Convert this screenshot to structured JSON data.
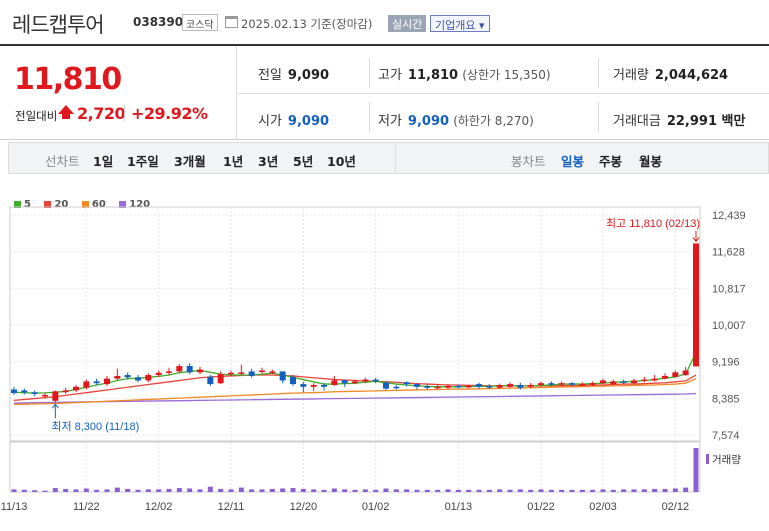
{
  "header": {
    "title": "레드캡투어",
    "code": "038390",
    "market_badge": "코스닥",
    "date": "2025.02.13 기준(장마감)",
    "realtime_label": "실시간",
    "company_label": "기업개요 ▾"
  },
  "summary": {
    "price": "11,810",
    "change_label": "전일대비",
    "change": "2,720",
    "change_pct": "+29.92%",
    "prev_close_label": "전일",
    "prev_close": "9,090",
    "high_label": "고가",
    "high": "11,810",
    "upper_limit": "(상한가 15,350)",
    "volume_label": "거래량",
    "volume": "2,044,624",
    "open_label": "시가",
    "open": "9,090",
    "low_label": "저가",
    "low": "9,090",
    "lower_limit": "(하한가 8,270)",
    "amount_label": "거래대금",
    "amount": "22,991 백만"
  },
  "period": {
    "line_label": "선차트",
    "line_options": [
      "1일",
      "1주일",
      "3개월",
      "1년",
      "3년",
      "5년",
      "10년"
    ],
    "candle_label": "봉차트",
    "candle_options": [
      "일봉",
      "주봉",
      "월봉"
    ],
    "active_candle": "일봉"
  },
  "colors": {
    "up": "#e0181d",
    "down": "#1460c0",
    "ma5": "#3fae2a",
    "ma20": "#e8443a",
    "ma60": "#f08a22",
    "ma120": "#9b6cd6"
  },
  "chart_data": {
    "type": "candlestick",
    "legend": [
      "5",
      "20",
      "60",
      "120"
    ],
    "y_ticks": [
      "12,439",
      "11,628",
      "10,817",
      "10,007",
      "9,196",
      "8,385",
      "7,574"
    ],
    "ylim": [
      7574,
      12439
    ],
    "x_ticks": [
      "11/13",
      "11/22",
      "12/02",
      "12/11",
      "12/20",
      "01/02",
      "01/13",
      "01/22",
      "02/03",
      "02/12"
    ],
    "max_annotation": "최고 11,810 (02/13)",
    "min_annotation": "최저 8,300 (11/18)",
    "volume_label": "거래량",
    "candles": [
      {
        "o": 8580,
        "c": 8500,
        "h": 8640,
        "l": 8460
      },
      {
        "o": 8560,
        "c": 8520,
        "h": 8600,
        "l": 8470
      },
      {
        "o": 8520,
        "c": 8480,
        "h": 8560,
        "l": 8430
      },
      {
        "o": 8440,
        "c": 8460,
        "h": 8500,
        "l": 8380
      },
      {
        "o": 8330,
        "c": 8540,
        "h": 8560,
        "l": 8300
      },
      {
        "o": 8520,
        "c": 8560,
        "h": 8620,
        "l": 8480
      },
      {
        "o": 8560,
        "c": 8640,
        "h": 8680,
        "l": 8520
      },
      {
        "o": 8620,
        "c": 8760,
        "h": 8800,
        "l": 8580
      },
      {
        "o": 8760,
        "c": 8720,
        "h": 8820,
        "l": 8680
      },
      {
        "o": 8700,
        "c": 8820,
        "h": 8880,
        "l": 8660
      },
      {
        "o": 8820,
        "c": 8880,
        "h": 9040,
        "l": 8780
      },
      {
        "o": 8900,
        "c": 8850,
        "h": 8960,
        "l": 8800
      },
      {
        "o": 8850,
        "c": 8780,
        "h": 8900,
        "l": 8740
      },
      {
        "o": 8780,
        "c": 8900,
        "h": 8940,
        "l": 8740
      },
      {
        "o": 8900,
        "c": 8950,
        "h": 9000,
        "l": 8860
      },
      {
        "o": 8960,
        "c": 8980,
        "h": 9060,
        "l": 8900
      },
      {
        "o": 8980,
        "c": 9100,
        "h": 9140,
        "l": 8940
      },
      {
        "o": 9100,
        "c": 8960,
        "h": 9160,
        "l": 8920
      },
      {
        "o": 8960,
        "c": 9020,
        "h": 9080,
        "l": 8920
      },
      {
        "o": 8860,
        "c": 8700,
        "h": 8900,
        "l": 8660
      },
      {
        "o": 8720,
        "c": 8920,
        "h": 8980,
        "l": 8700
      },
      {
        "o": 8920,
        "c": 8950,
        "h": 9000,
        "l": 8880
      },
      {
        "o": 8950,
        "c": 8960,
        "h": 9130,
        "l": 8900
      },
      {
        "o": 8980,
        "c": 8880,
        "h": 9040,
        "l": 8840
      },
      {
        "o": 8980,
        "c": 9000,
        "h": 9060,
        "l": 8940
      },
      {
        "o": 8960,
        "c": 8980,
        "h": 9020,
        "l": 8920
      },
      {
        "o": 8980,
        "c": 8780,
        "h": 8940,
        "l": 8720
      },
      {
        "o": 8860,
        "c": 8700,
        "h": 8900,
        "l": 8660
      },
      {
        "o": 8700,
        "c": 8640,
        "h": 8750,
        "l": 8520
      },
      {
        "o": 8640,
        "c": 8680,
        "h": 8720,
        "l": 8540
      },
      {
        "o": 8680,
        "c": 8640,
        "h": 8720,
        "l": 8560
      },
      {
        "o": 8680,
        "c": 8780,
        "h": 8880,
        "l": 8660
      },
      {
        "o": 8780,
        "c": 8720,
        "h": 8800,
        "l": 8640
      },
      {
        "o": 8720,
        "c": 8760,
        "h": 8800,
        "l": 8700
      },
      {
        "o": 8760,
        "c": 8800,
        "h": 8840,
        "l": 8720
      },
      {
        "o": 8800,
        "c": 8760,
        "h": 8840,
        "l": 8720
      },
      {
        "o": 8730,
        "c": 8600,
        "h": 8760,
        "l": 8560
      },
      {
        "o": 8640,
        "c": 8620,
        "h": 8680,
        "l": 8580
      },
      {
        "o": 8740,
        "c": 8700,
        "h": 8760,
        "l": 8650
      },
      {
        "o": 8700,
        "c": 8640,
        "h": 8720,
        "l": 8580
      },
      {
        "o": 8650,
        "c": 8620,
        "h": 8690,
        "l": 8580
      },
      {
        "o": 8620,
        "c": 8640,
        "h": 8680,
        "l": 8590
      },
      {
        "o": 8620,
        "c": 8660,
        "h": 8700,
        "l": 8590
      },
      {
        "o": 8660,
        "c": 8650,
        "h": 8690,
        "l": 8610
      },
      {
        "o": 8650,
        "c": 8660,
        "h": 8690,
        "l": 8610
      },
      {
        "o": 8700,
        "c": 8640,
        "h": 8730,
        "l": 8600
      },
      {
        "o": 8660,
        "c": 8620,
        "h": 8700,
        "l": 8590
      },
      {
        "o": 8620,
        "c": 8680,
        "h": 8710,
        "l": 8600
      },
      {
        "o": 8640,
        "c": 8700,
        "h": 8740,
        "l": 8610
      },
      {
        "o": 8680,
        "c": 8620,
        "h": 8730,
        "l": 8580
      },
      {
        "o": 8640,
        "c": 8680,
        "h": 8720,
        "l": 8610
      },
      {
        "o": 8680,
        "c": 8720,
        "h": 8760,
        "l": 8640
      },
      {
        "o": 8720,
        "c": 8690,
        "h": 8760,
        "l": 8650
      },
      {
        "o": 8690,
        "c": 8720,
        "h": 8760,
        "l": 8660
      },
      {
        "o": 8720,
        "c": 8690,
        "h": 8750,
        "l": 8650
      },
      {
        "o": 8690,
        "c": 8700,
        "h": 8740,
        "l": 8660
      },
      {
        "o": 8700,
        "c": 8720,
        "h": 8760,
        "l": 8660
      },
      {
        "o": 8720,
        "c": 8780,
        "h": 8820,
        "l": 8700
      },
      {
        "o": 8700,
        "c": 8760,
        "h": 8800,
        "l": 8680
      },
      {
        "o": 8760,
        "c": 8740,
        "h": 8800,
        "l": 8700
      },
      {
        "o": 8720,
        "c": 8780,
        "h": 8820,
        "l": 8700
      },
      {
        "o": 8780,
        "c": 8800,
        "h": 8860,
        "l": 8740
      },
      {
        "o": 8780,
        "c": 8820,
        "h": 8900,
        "l": 8760
      },
      {
        "o": 8820,
        "c": 8880,
        "h": 8940,
        "l": 8800
      },
      {
        "o": 8860,
        "c": 8960,
        "h": 9000,
        "l": 8840
      },
      {
        "o": 8900,
        "c": 9000,
        "h": 9080,
        "l": 8880
      },
      {
        "o": 9090,
        "c": 11810,
        "h": 11810,
        "l": 9090
      }
    ],
    "ma5": [
      8520,
      8510,
      8500,
      8505,
      8520,
      8540,
      8580,
      8630,
      8680,
      8720,
      8780,
      8820,
      8830,
      8850,
      8870,
      8900,
      8950,
      8980,
      9000,
      8960,
      8920,
      8900,
      8900,
      8900,
      8920,
      8940,
      8900,
      8850,
      8800,
      8750,
      8700,
      8700,
      8710,
      8720,
      8740,
      8760,
      8730,
      8700,
      8680,
      8660,
      8650,
      8640,
      8640,
      8640,
      8650,
      8650,
      8650,
      8660,
      8670,
      8660,
      8660,
      8670,
      8680,
      8700,
      8700,
      8700,
      8710,
      8720,
      8740,
      8750,
      8760,
      8780,
      8800,
      8830,
      8860,
      8920,
      9400
    ],
    "ma20": [
      8340,
      8360,
      8380,
      8400,
      8420,
      8450,
      8480,
      8510,
      8540,
      8570,
      8600,
      8630,
      8660,
      8690,
      8720,
      8750,
      8780,
      8810,
      8840,
      8860,
      8870,
      8880,
      8890,
      8900,
      8900,
      8900,
      8890,
      8880,
      8860,
      8840,
      8820,
      8800,
      8790,
      8780,
      8770,
      8760,
      8750,
      8740,
      8720,
      8710,
      8700,
      8690,
      8680,
      8680,
      8670,
      8670,
      8660,
      8660,
      8660,
      8660,
      8660,
      8660,
      8660,
      8665,
      8670,
      8670,
      8680,
      8680,
      8690,
      8700,
      8700,
      8710,
      8720,
      8730,
      8750,
      8770,
      8900
    ],
    "ma60": [
      8250,
      8255,
      8260,
      8265,
      8270,
      8280,
      8290,
      8300,
      8310,
      8320,
      8330,
      8340,
      8350,
      8360,
      8370,
      8380,
      8390,
      8400,
      8410,
      8420,
      8430,
      8440,
      8450,
      8460,
      8470,
      8480,
      8490,
      8500,
      8505,
      8510,
      8520,
      8530,
      8535,
      8540,
      8545,
      8550,
      8555,
      8560,
      8565,
      8570,
      8575,
      8580,
      8585,
      8590,
      8590,
      8595,
      8600,
      8605,
      8610,
      8615,
      8620,
      8625,
      8630,
      8635,
      8640,
      8645,
      8650,
      8655,
      8660,
      8665,
      8670,
      8675,
      8680,
      8690,
      8700,
      8720,
      8820
    ],
    "ma120": [
      8280,
      8285,
      8290,
      8293,
      8296,
      8300,
      8303,
      8306,
      8309,
      8312,
      8315,
      8318,
      8321,
      8324,
      8327,
      8330,
      8333,
      8336,
      8339,
      8342,
      8345,
      8348,
      8351,
      8354,
      8357,
      8360,
      8363,
      8366,
      8369,
      8372,
      8375,
      8378,
      8381,
      8384,
      8387,
      8390,
      8393,
      8396,
      8399,
      8402,
      8405,
      8408,
      8411,
      8414,
      8417,
      8420,
      8423,
      8426,
      8429,
      8432,
      8435,
      8438,
      8441,
      8444,
      8447,
      8450,
      8453,
      8456,
      8459,
      8462,
      8465,
      8468,
      8471,
      8474,
      8477,
      8480,
      8490
    ],
    "volumes": [
      6,
      5,
      4,
      3,
      9,
      7,
      6,
      8,
      5,
      6,
      10,
      7,
      5,
      6,
      6,
      7,
      9,
      8,
      6,
      12,
      7,
      6,
      10,
      6,
      6,
      7,
      8,
      9,
      7,
      6,
      5,
      8,
      6,
      5,
      6,
      5,
      8,
      6,
      6,
      5,
      5,
      5,
      6,
      5,
      5,
      5,
      5,
      6,
      5,
      6,
      5,
      6,
      5,
      5,
      5,
      5,
      5,
      6,
      5,
      6,
      6,
      6,
      7,
      7,
      8,
      10,
      100
    ]
  }
}
